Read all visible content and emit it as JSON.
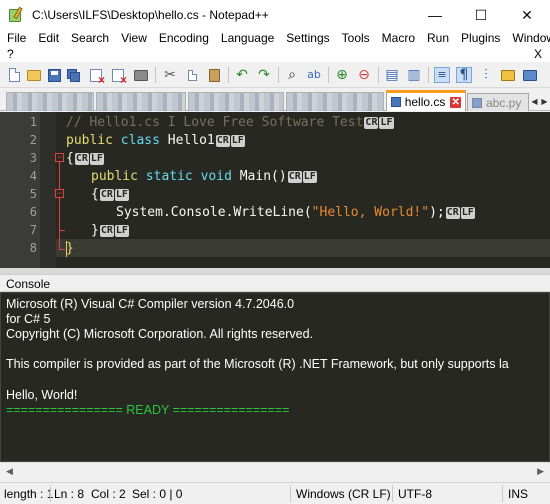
{
  "window": {
    "title": "C:\\Users\\ILFS\\Desktop\\hello.cs - Notepad++",
    "minimize": "—",
    "maximize": "☐",
    "close": "✕"
  },
  "menu": {
    "items": [
      "File",
      "Edit",
      "Search",
      "View",
      "Encoding",
      "Language",
      "Settings",
      "Tools",
      "Macro",
      "Run",
      "Plugins",
      "Window"
    ],
    "help": "?",
    "close_doc": "X"
  },
  "toolbar": {
    "icons": [
      "new-file-icon",
      "open-file-icon",
      "save-icon",
      "save-all-icon",
      "close-file-icon",
      "close-all-icon",
      "print-icon",
      "cut-icon",
      "copy-icon",
      "paste-icon",
      "undo-icon",
      "redo-icon",
      "find-icon",
      "replace-icon",
      "zoom-in-icon",
      "zoom-out-icon",
      "sync-vertical-icon",
      "sync-horizontal-icon",
      "word-wrap-icon",
      "show-all-chars-icon",
      "indent-guide-icon",
      "user-language-icon",
      "doc-map-icon"
    ]
  },
  "tabs": [
    {
      "label": "hello.cs",
      "active": true,
      "close": "✕"
    },
    {
      "label": "abc.py",
      "active": false,
      "close": "✕"
    }
  ],
  "editor": {
    "line_numbers": [
      "1",
      "2",
      "3",
      "4",
      "5",
      "6",
      "7",
      "8"
    ],
    "eol": "CRLF",
    "eol_cr": "CR",
    "eol_lf": "LF",
    "lines": {
      "l1_comment": "// Hello1.cs I Love Free Software Test",
      "l2_kw1": "public",
      "l2_kw2": "class",
      "l2_name": "Hello1",
      "l3_brace": "{",
      "l4_kw1": "public",
      "l4_kw2": "static",
      "l4_kw3": "void",
      "l4_name": "Main()",
      "l5_brace": "{",
      "l6_call": "System.Console.WriteLine(",
      "l6_str": "\"Hello, World!\"",
      "l6_end": ");",
      "l7_brace": "}",
      "l8_brace": "}"
    }
  },
  "console": {
    "title": "Console",
    "lines": [
      "Microsoft (R) Visual C# Compiler version 4.7.2046.0",
      "for C# 5",
      "Copyright (C) Microsoft Corporation. All rights reserved.",
      "",
      "This compiler is provided as part of the Microsoft (R) .NET Framework, but only supports la",
      "",
      "Hello, World!"
    ],
    "ready": "================ READY ================"
  },
  "status": {
    "length": "length : 1",
    "ln": "Ln : 8",
    "col": "Col : 2",
    "sel": "Sel : 0 | 0",
    "eol_mode": "Windows (CR LF)",
    "encoding": "UTF-8",
    "ins": "INS"
  }
}
